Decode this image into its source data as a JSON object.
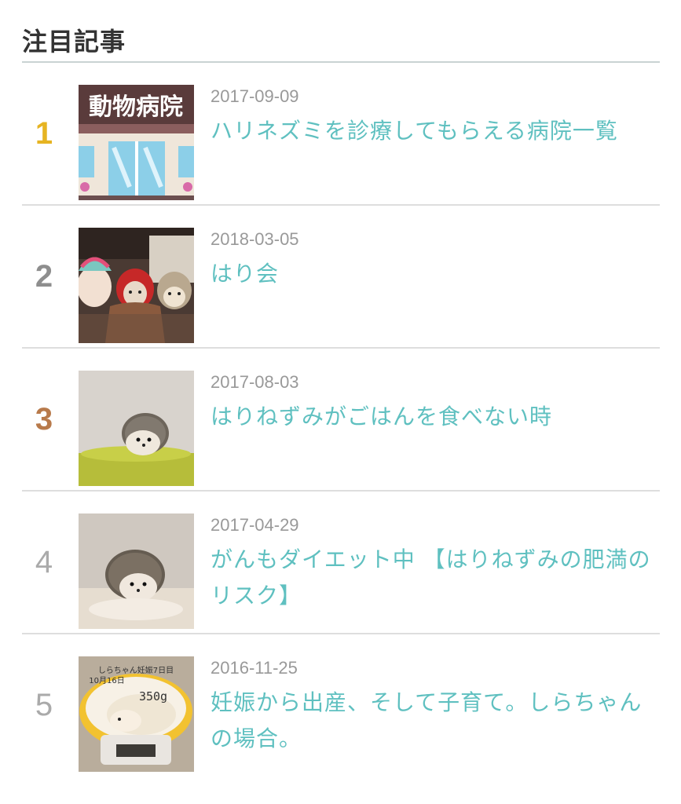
{
  "widget": {
    "title": "注目記事"
  },
  "entries": [
    {
      "rank": "1",
      "date": "2017-09-09",
      "title": "ハリネズミを診療してもらえる病院一覧",
      "thumb_text": "動物病院",
      "rank_color": "#e6b422"
    },
    {
      "rank": "2",
      "date": "2018-03-05",
      "title": "はり会",
      "rank_color": "#8e8e8e"
    },
    {
      "rank": "3",
      "date": "2017-08-03",
      "title": "はりねずみがごはんを食べない時",
      "rank_color": "#b87a4b"
    },
    {
      "rank": "4",
      "date": "2017-04-29",
      "title": "がんもダイエット中 【はりねずみの肥満のリスク】",
      "rank_color": "#aaaaaa"
    },
    {
      "rank": "5",
      "date": "2016-11-25",
      "title": "妊娠から出産、そして子育て。しらちゃんの場合。",
      "thumb_text_1": "しらちゃん妊娠7日目",
      "thumb_text_2": "10月16日",
      "thumb_text_3": "350g",
      "rank_color": "#aaaaaa"
    }
  ],
  "colors": {
    "link": "#5fc0c0",
    "date": "#999999",
    "divider": "#dedede"
  }
}
